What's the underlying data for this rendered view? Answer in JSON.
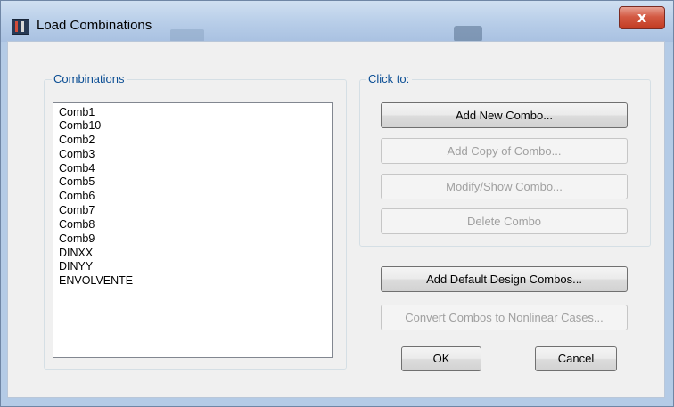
{
  "window": {
    "title": "Load Combinations",
    "close_glyph": "x",
    "icon_name": "sap2000-app-icon"
  },
  "combinations_group": {
    "label": "Combinations",
    "items": [
      "Comb1",
      "Comb10",
      "Comb2",
      "Comb3",
      "Comb4",
      "Comb5",
      "Comb6",
      "Comb7",
      "Comb8",
      "Comb9",
      "DINXX",
      "DINYY",
      "ENVOLVENTE"
    ]
  },
  "click_to_group": {
    "label": "Click to:",
    "buttons": {
      "add_new": "Add New Combo...",
      "add_copy": "Add Copy of Combo...",
      "modify_show": "Modify/Show Combo...",
      "delete": "Delete Combo"
    }
  },
  "actions": {
    "add_default": "Add Default Design Combos...",
    "convert": "Convert Combos to Nonlinear Cases...",
    "ok": "OK",
    "cancel": "Cancel"
  },
  "colors": {
    "group_label": "#0b4e94",
    "titlebar": "#b7cde8",
    "close_button": "#c23b22",
    "dialog_face": "#f0f0f0"
  }
}
